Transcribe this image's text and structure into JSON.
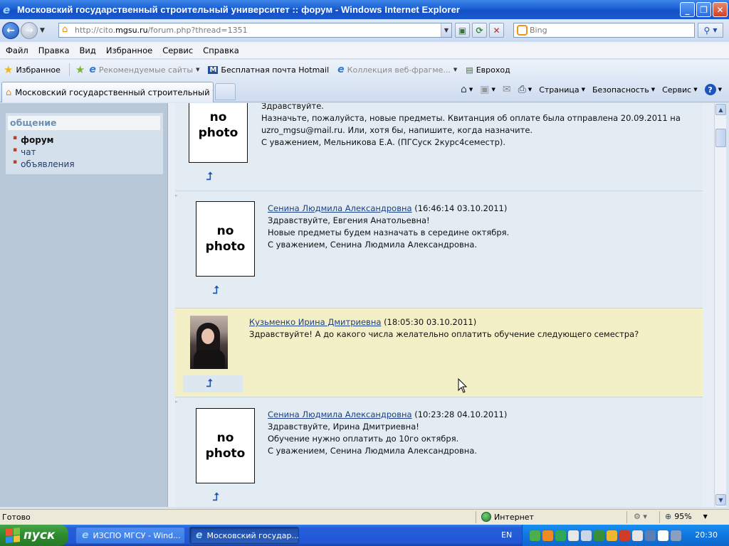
{
  "window": {
    "title": "Московский государственный строительный университет :: форум - Windows Internet Explorer"
  },
  "address": {
    "url_prefix": "http://cito.",
    "url_host": "mgsu.ru",
    "url_path": "/forum.php?thread=1351",
    "search_placeholder": "Bing"
  },
  "menu": [
    "Файл",
    "Правка",
    "Вид",
    "Избранное",
    "Сервис",
    "Справка"
  ],
  "favorites": {
    "favorites_label": "Избранное",
    "items": [
      {
        "label": "Рекомендуемые сайты",
        "disabled": true
      },
      {
        "label": "Бесплатная почта Hotmail",
        "disabled": false
      },
      {
        "label": "Коллекция веб-фрагме...",
        "disabled": true
      },
      {
        "label": "Евроход",
        "disabled": false
      }
    ]
  },
  "tab": {
    "label": "Московский государственный строительный унив..."
  },
  "commandbar": {
    "page": "Страница",
    "safety": "Безопасность",
    "tools": "Сервис"
  },
  "sidebar": {
    "heading": "общение",
    "items": [
      {
        "label": "форум",
        "active": true
      },
      {
        "label": "чат",
        "active": false
      },
      {
        "label": "объявления",
        "active": false
      }
    ]
  },
  "posts": [
    {
      "photo_text": "no photo",
      "lines": [
        "Здравствуйте.",
        "Назначьте, пожалуйста, новые предметы. Квитанция об оплате была отправлена 20.09.2011 на",
        "uzro_mgsu@mail.ru. Или, хотя бы, напишите, когда назначите.",
        "С уважением, Мельникова Е.А. (ПГСуск 2курс4семестр)."
      ]
    },
    {
      "photo_text": "no photo",
      "author": "Сенина Людмила Александровна",
      "time": "(16:46:14 03.10.2011)",
      "lines": [
        "Здравствуйте, Евгения Анатольевна!",
        "Новые предметы будем назначать в середине октября.",
        "С уважением, Сенина Людмила Александровна."
      ]
    },
    {
      "author": "Кузьменко Ирина Дмитриевна",
      "time": "(18:05:30 03.10.2011)",
      "lines": [
        "Здравствуйте! А до какого числа желательно оплатить обучение следующего семестра?"
      ]
    },
    {
      "photo_text": "no photo",
      "author": "Сенина Людмила Александровна",
      "time": "(10:23:28 04.10.2011)",
      "lines": [
        "Здравствуйте, Ирина Дмитриевна!",
        "Обучение нужно оплатить до 10го октября.",
        "С уважением, Сенина Людмила Александровна."
      ]
    }
  ],
  "status": {
    "ready": "Готово",
    "zone": "Интернет",
    "zoom": "95%"
  },
  "taskbar": {
    "start": "пуск",
    "items": [
      "ИЗСПО МГСУ - Wind...",
      "Московский государ..."
    ],
    "lang": "EN",
    "clock": "20:30"
  },
  "colors": {
    "highlight_post": "#f3f0c8",
    "sidebar_panel": "#b8c8d8",
    "link": "#1a3f8a"
  }
}
